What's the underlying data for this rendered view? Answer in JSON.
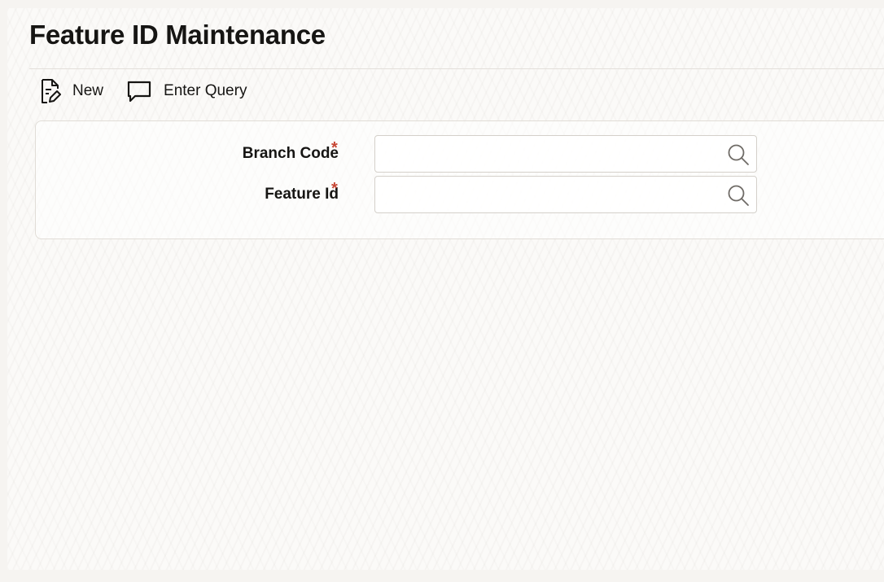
{
  "page": {
    "title": "Feature ID Maintenance"
  },
  "toolbar": {
    "new_label": "New",
    "enter_query_label": "Enter Query"
  },
  "form": {
    "fields": [
      {
        "label": "Branch Code",
        "required_marker": "*",
        "value": "",
        "placeholder": "",
        "lookup_icon": "search-icon"
      },
      {
        "label": "Feature Id",
        "required_marker": "*",
        "value": "",
        "placeholder": "",
        "lookup_icon": "search-icon"
      }
    ]
  },
  "colors": {
    "text": "#161513",
    "required": "#c74634",
    "border": "#d4d0ca",
    "panel_border": "#e1ddd7"
  }
}
